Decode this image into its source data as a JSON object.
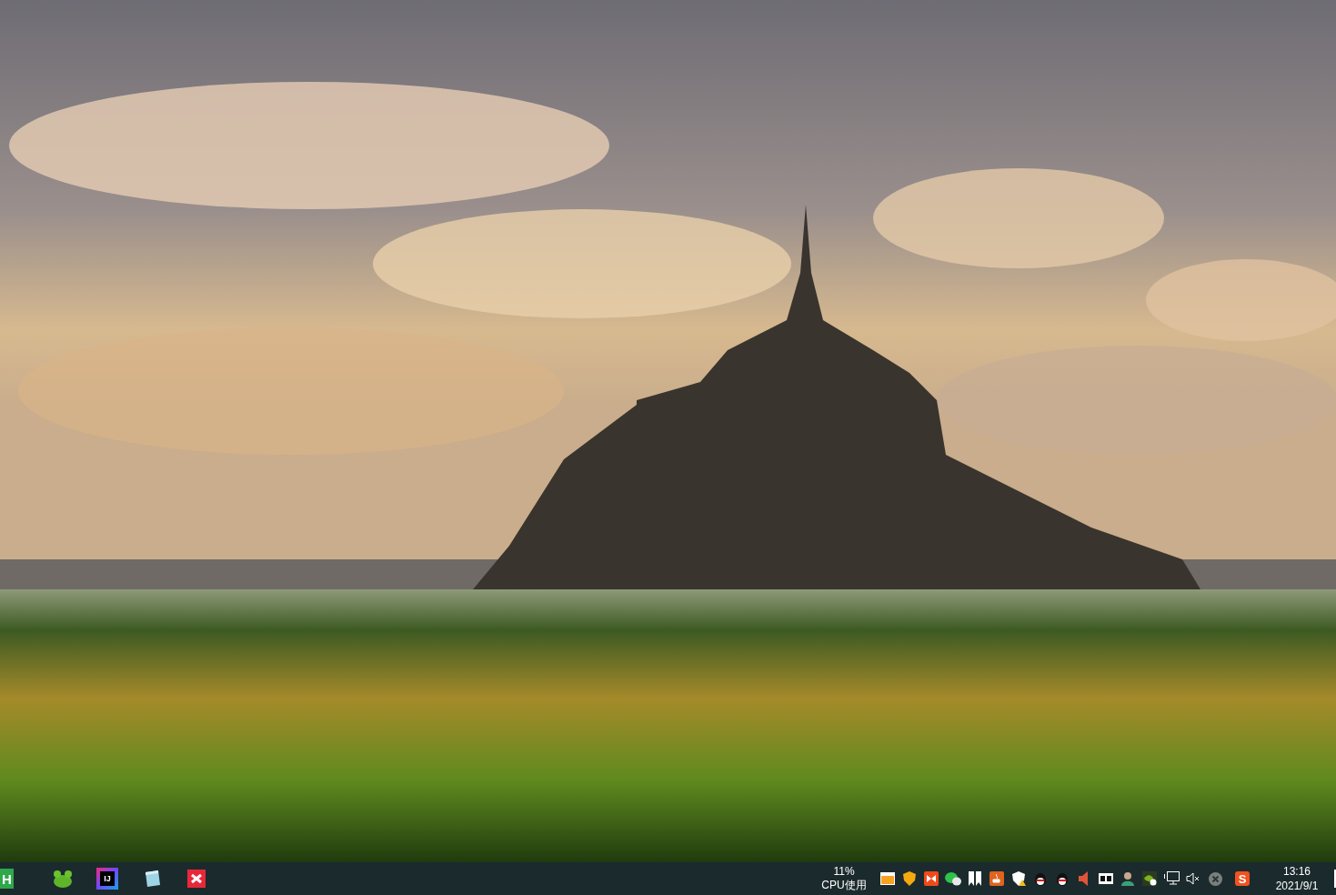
{
  "taskbar": {
    "apps": [
      {
        "kind": "hbuilder",
        "glyph": "H"
      },
      {
        "kind": "frog"
      },
      {
        "kind": "ide",
        "glyph": "IJ"
      },
      {
        "kind": "notepad"
      },
      {
        "kind": "xmind"
      }
    ],
    "cpu": {
      "value": "11%",
      "label": "CPU使用"
    },
    "tray": [
      {
        "kind": "window"
      },
      {
        "kind": "shield"
      },
      {
        "kind": "bowtie"
      },
      {
        "kind": "chat"
      },
      {
        "kind": "bookmark"
      },
      {
        "kind": "java"
      },
      {
        "kind": "warnshield"
      },
      {
        "kind": "penguin"
      },
      {
        "kind": "penguin"
      },
      {
        "kind": "speaker"
      },
      {
        "kind": "film"
      },
      {
        "kind": "person"
      },
      {
        "kind": "gpu"
      },
      {
        "kind": "network"
      },
      {
        "kind": "mute"
      },
      {
        "kind": "closecircle"
      },
      {
        "kind": "sogou",
        "glyph": "S"
      }
    ],
    "clock": {
      "time": "13:16",
      "date": "2021/9/1"
    }
  }
}
